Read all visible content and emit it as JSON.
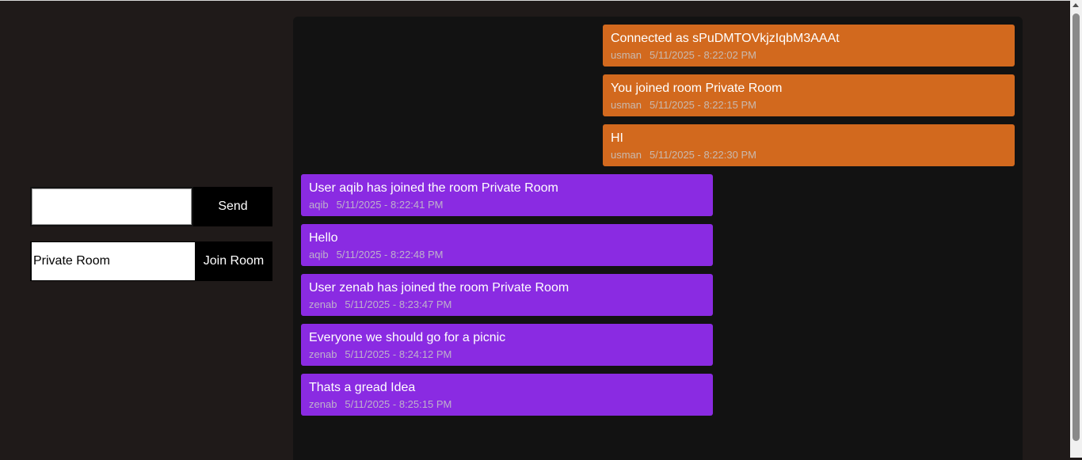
{
  "composer": {
    "message_value": "",
    "send_label": "Send",
    "room_value": "Private Room",
    "join_label": "Join Room"
  },
  "messages": [
    {
      "type": "self",
      "text": "Connected as sPuDMTOVkjzIqbM3AAAt",
      "user": "usman",
      "time": "5/11/2025 - 8:22:02 PM"
    },
    {
      "type": "self",
      "text": "You joined room Private Room",
      "user": "usman",
      "time": "5/11/2025 - 8:22:15 PM"
    },
    {
      "type": "self",
      "text": "HI",
      "user": "usman",
      "time": "5/11/2025 - 8:22:30 PM"
    },
    {
      "type": "other",
      "text": "User aqib has joined the room Private Room",
      "user": "aqib",
      "time": "5/11/2025 - 8:22:41 PM"
    },
    {
      "type": "other",
      "text": "Hello",
      "user": "aqib",
      "time": "5/11/2025 - 8:22:48 PM"
    },
    {
      "type": "other",
      "text": "User zenab has joined the room Private Room",
      "user": "zenab",
      "time": "5/11/2025 - 8:23:47 PM"
    },
    {
      "type": "other",
      "text": "Everyone we should go for a picnic",
      "user": "zenab",
      "time": "5/11/2025 - 8:24:12 PM"
    },
    {
      "type": "other",
      "text": "Thats a gread Idea",
      "user": "zenab",
      "time": "5/11/2025 - 8:25:15 PM"
    }
  ],
  "colors": {
    "self_bubble": "#d2691e",
    "other_bubble": "#8a2be2",
    "background": "#1f1a19",
    "chat_background": "#121212"
  }
}
